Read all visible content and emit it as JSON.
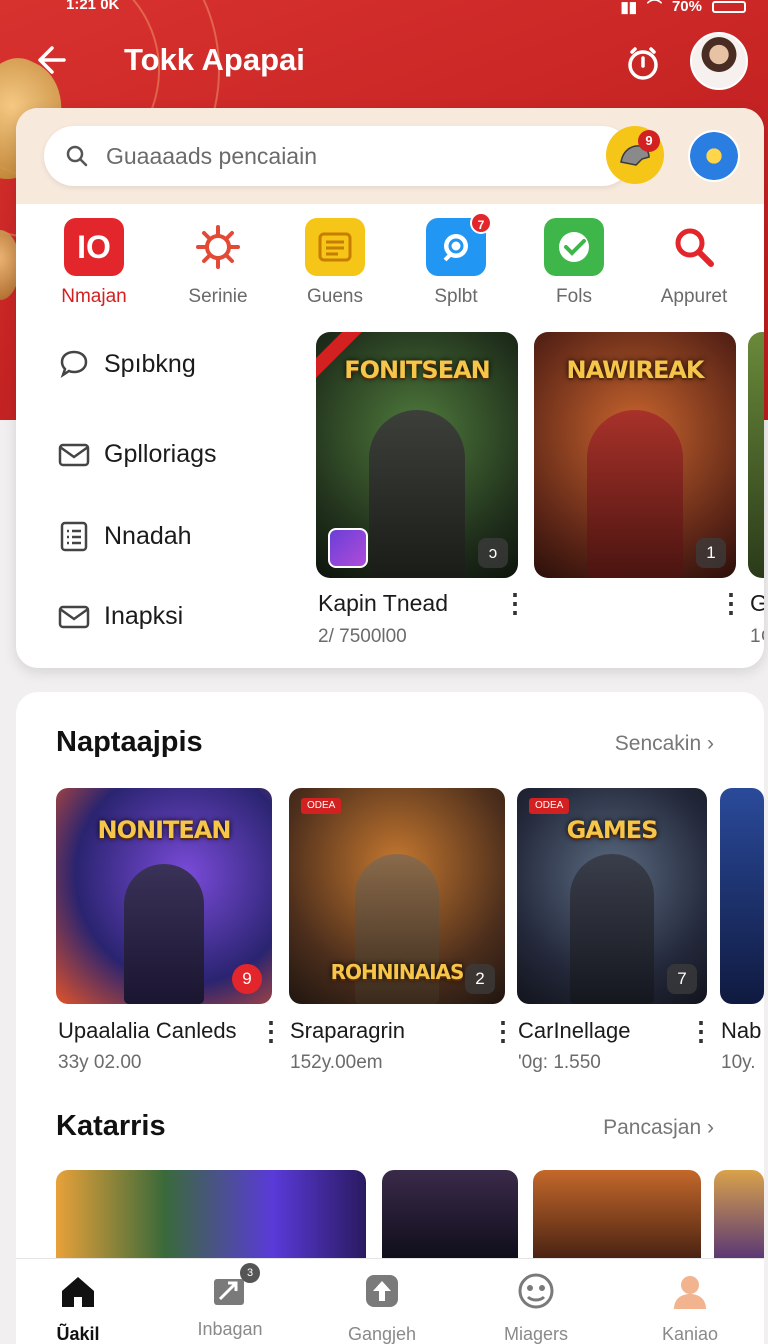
{
  "status": {
    "time": "1:21 0K",
    "battery": "70%"
  },
  "header": {
    "title": "Tokk Apapai"
  },
  "search": {
    "placeholder": "Guaaaads pencaiain",
    "helmet_badge": "9"
  },
  "categories": [
    {
      "label": "Nmajan",
      "icon": "logo-10-icon",
      "color": "#e3262b",
      "active": true
    },
    {
      "label": "Serinie",
      "icon": "gear-icon",
      "color": "#e34a36"
    },
    {
      "label": "Guens",
      "icon": "list-card-icon",
      "color": "#f5c518"
    },
    {
      "label": "Splbt",
      "icon": "chat-bubble-icon",
      "color": "#2196f3",
      "badge": "7"
    },
    {
      "label": "Fols",
      "icon": "check-icon",
      "color": "#3fb64a"
    },
    {
      "label": "Appuret",
      "icon": "search-icon",
      "color": "#e3262b"
    }
  ],
  "side_menu": [
    {
      "label": "Spıbkng",
      "icon": "chat-icon"
    },
    {
      "label": "Gpllori­ags",
      "icon": "envelope-icon"
    },
    {
      "label": "Nnadah",
      "icon": "list-icon"
    },
    {
      "label": "Inapksi",
      "icon": "envelope-icon"
    }
  ],
  "featured": [
    {
      "art_title": "FONITSEAN",
      "badge": "ↄ",
      "title": "Kapin Tnead",
      "meta": "2/ 7500l00"
    },
    {
      "art_title": "NAWIREAK",
      "badge": "1",
      "title": "",
      "meta": ""
    },
    {
      "title": "G",
      "meta": "1¢"
    }
  ],
  "section1": {
    "title": "Naptaajpis",
    "more": "Sencakin",
    "items": [
      {
        "art_title": "NONITEAN",
        "badge": "9",
        "name": "Upaalalia Canleds",
        "meta": "33y 02.00"
      },
      {
        "art_title": "ROHNINAIAS",
        "badge": "2",
        "name": "Sraparagrin",
        "meta": "152y.00em"
      },
      {
        "art_title": "GAMES",
        "badge": "7",
        "name": "CarInellage",
        "meta": "'0g: 1.550"
      },
      {
        "art_title": "",
        "badge": "",
        "name": "Nab",
        "meta": "10y."
      }
    ]
  },
  "section2": {
    "title": "Katarris",
    "more": "Pancasjan"
  },
  "bottom_nav": [
    {
      "label": "Ũakil",
      "icon": "home-icon",
      "active": true
    },
    {
      "label": "Inbagan",
      "icon": "inbox-icon",
      "badge": "3"
    },
    {
      "label": "Gangjeh",
      "icon": "upload-icon"
    },
    {
      "label": "Miagers",
      "icon": "face-icon"
    },
    {
      "label": "Kaniao",
      "icon": "profile-icon"
    }
  ],
  "colors": {
    "brand_red": "#d32020",
    "header_red": "#c52323"
  }
}
